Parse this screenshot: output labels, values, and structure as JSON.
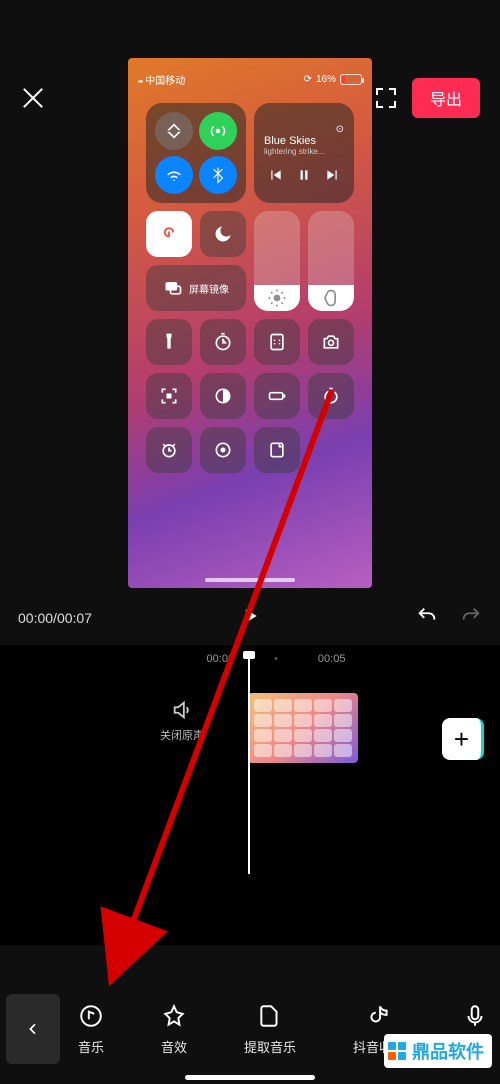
{
  "header": {
    "export_label": "导出"
  },
  "preview_status": {
    "carrier": "中国移动",
    "battery_text": "16%"
  },
  "music": {
    "title": "Blue Skies",
    "subtitle": "lightering strike..."
  },
  "screen_mirror_label": "屏幕镜像",
  "play": {
    "elapsed": "00:00",
    "total": "00:07"
  },
  "ticks": {
    "a": "00:00",
    "b": "00:05"
  },
  "mute_label": "关闭原声",
  "tools": {
    "music": "音乐",
    "sfx": "音效",
    "extract": "提取音乐",
    "douyin": "抖音收藏",
    "record": "录音"
  },
  "watermark": "鼎品软件"
}
